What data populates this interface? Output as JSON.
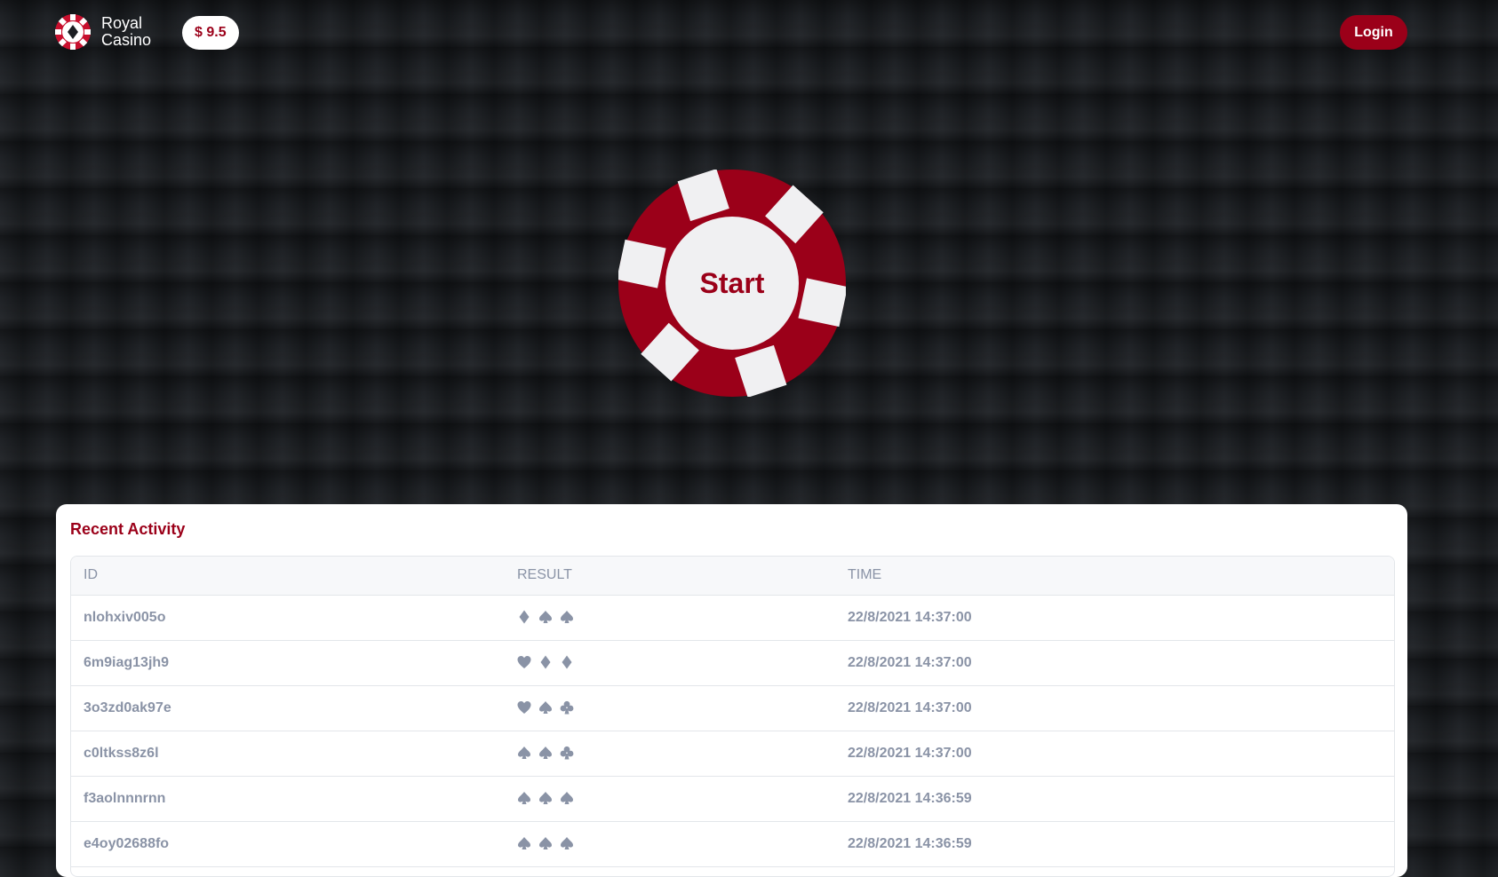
{
  "header": {
    "brand": {
      "line1": "Royal",
      "line2": "Casino",
      "logo_icon": "poker-chip-logo-icon"
    },
    "balance": "$ 9.5",
    "login_label": "Login"
  },
  "game": {
    "start_label": "Start",
    "chip_icon": "poker-chip-icon",
    "accent_color": "#9b0019"
  },
  "activity": {
    "title": "Recent Activity",
    "columns": [
      "ID",
      "RESULT",
      "TIME"
    ],
    "rows": [
      {
        "id": "nlohxiv005o",
        "result": [
          "diamond",
          "spade",
          "spade"
        ],
        "time": "22/8/2021 14:37:00"
      },
      {
        "id": "6m9iag13jh9",
        "result": [
          "heart",
          "diamond",
          "diamond"
        ],
        "time": "22/8/2021 14:37:00"
      },
      {
        "id": "3o3zd0ak97e",
        "result": [
          "heart",
          "spade",
          "club"
        ],
        "time": "22/8/2021 14:37:00"
      },
      {
        "id": "c0ltkss8z6l",
        "result": [
          "spade",
          "spade",
          "club"
        ],
        "time": "22/8/2021 14:37:00"
      },
      {
        "id": "f3aolnnnrnn",
        "result": [
          "spade",
          "spade",
          "spade"
        ],
        "time": "22/8/2021 14:36:59"
      },
      {
        "id": "e4oy02688fo",
        "result": [
          "spade",
          "spade",
          "spade"
        ],
        "time": "22/8/2021 14:36:59"
      }
    ]
  }
}
